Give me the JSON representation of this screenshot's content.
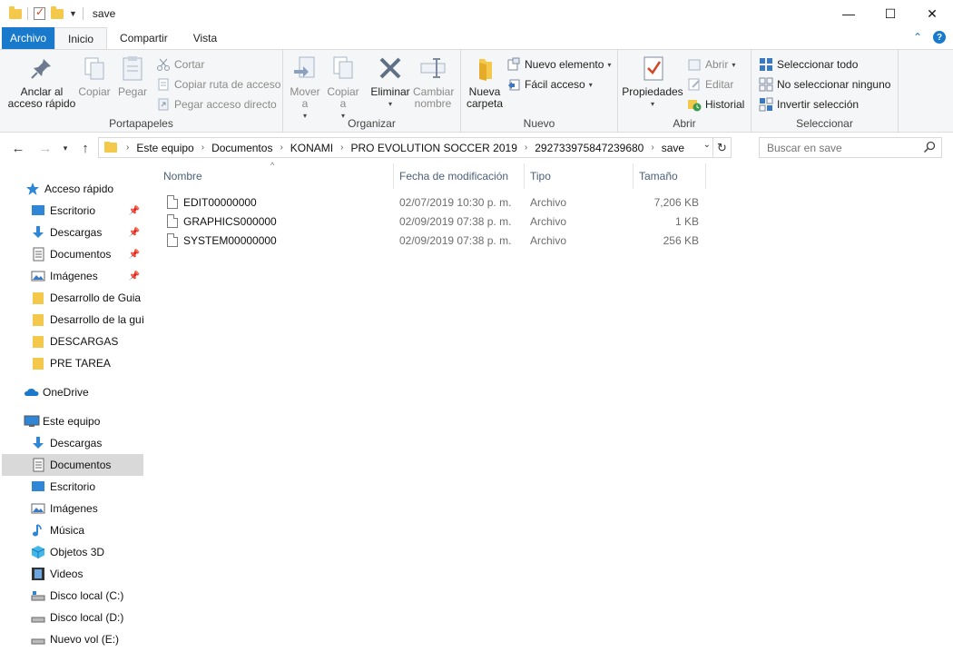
{
  "window": {
    "title": "save",
    "controls": {
      "minimize": "—",
      "maximize": "☐",
      "close": "✕"
    }
  },
  "ribbon_tabs": [
    {
      "label": "Archivo"
    },
    {
      "label": "Inicio"
    },
    {
      "label": "Compartir"
    },
    {
      "label": "Vista"
    }
  ],
  "ribbon": {
    "portapapeles": {
      "label": "Portapapeles",
      "pin_quick_access": "Anclar al acceso rápido",
      "copy": "Copiar",
      "paste": "Pegar",
      "cut": "Cortar",
      "copy_path": "Copiar ruta de acceso",
      "paste_shortcut": "Pegar acceso directo"
    },
    "organizar": {
      "label": "Organizar",
      "move_to": "Mover a",
      "copy_to": "Copiar a",
      "delete": "Eliminar",
      "rename": "Cambiar nombre"
    },
    "nuevo": {
      "label": "Nuevo",
      "new_folder": "Nueva carpeta",
      "new_item": "Nuevo elemento",
      "easy_access": "Fácil acceso"
    },
    "abrir": {
      "label": "Abrir",
      "properties": "Propiedades",
      "open": "Abrir",
      "edit": "Editar",
      "history": "Historial"
    },
    "seleccionar": {
      "label": "Seleccionar",
      "select_all": "Seleccionar todo",
      "select_none": "No seleccionar ninguno",
      "invert_selection": "Invertir selección"
    }
  },
  "address": {
    "crumbs": [
      "Este equipo",
      "Documentos",
      "KONAMI",
      "PRO EVOLUTION SOCCER 2019",
      "292733975847239680",
      "save"
    ]
  },
  "search": {
    "placeholder": "Buscar en save"
  },
  "nav_pane": {
    "quick_access": "Acceso rápido",
    "quick_items": [
      "Escritorio",
      "Descargas",
      "Documentos",
      "Imágenes",
      "Desarrollo de Guia P",
      "Desarrollo de la guía",
      "DESCARGAS",
      "PRE TAREA"
    ],
    "onedrive": "OneDrive",
    "this_pc": "Este equipo",
    "pc_items": [
      "Descargas",
      "Documentos",
      "Escritorio",
      "Imágenes",
      "Música",
      "Objetos 3D",
      "Videos",
      "Disco local (C:)",
      "Disco local (D:)",
      "Nuevo vol (E:)"
    ]
  },
  "columns": {
    "name": "Nombre",
    "date": "Fecha de modificación",
    "type": "Tipo",
    "size": "Tamaño"
  },
  "files": [
    {
      "name": "EDIT00000000",
      "date": "02/07/2019 10:30 p. m.",
      "type": "Archivo",
      "size": "7,206 KB"
    },
    {
      "name": "GRAPHICS000000",
      "date": "02/09/2019 07:38 p. m.",
      "type": "Archivo",
      "size": "1 KB"
    },
    {
      "name": "SYSTEM00000000",
      "date": "02/09/2019 07:38 p. m.",
      "type": "Archivo",
      "size": "256 KB"
    }
  ],
  "colors": {
    "file_tab": "#1979ca",
    "ribbon_bg": "#f5f6f7",
    "selected_nav": "#d9d9d9",
    "folder": "#f4c84a",
    "column_header": "#4c607a"
  }
}
